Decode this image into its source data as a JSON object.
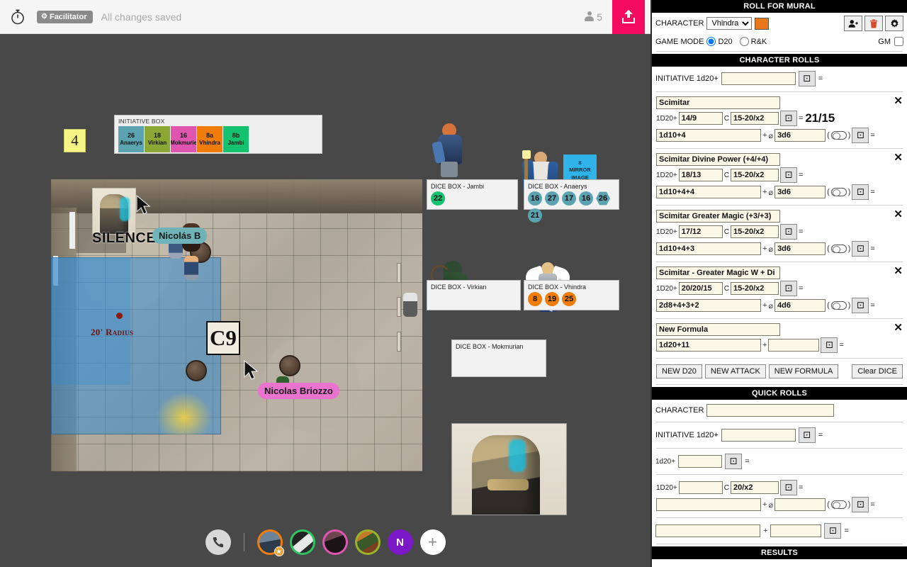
{
  "topbar": {
    "timer_icon": "stopwatch-icon",
    "facilitator_label": "Facilitator",
    "saved_status": "All changes saved",
    "people_count": "5",
    "share_icon": "upload-icon",
    "share_accent": "#f50b5d"
  },
  "canvas": {
    "counter_token": "4",
    "initiative": {
      "title": "INITIATIVE BOX",
      "cards": [
        {
          "num": "26",
          "name": "Anaerys",
          "color": "#5ba3b0"
        },
        {
          "num": "18",
          "name": "Virkian",
          "color": "#8aa833"
        },
        {
          "num": "16",
          "name": "Mokmurie",
          "color": "#e055b0"
        },
        {
          "num": "8a",
          "name": "Vhindra",
          "color": "#f07c0a"
        },
        {
          "num": "8b",
          "name": "Jambi",
          "color": "#14c270"
        }
      ]
    },
    "map": {
      "silence_label": "SILENCE",
      "grid_marker": "C9",
      "radius_label": "20' Radius",
      "nametag_teal": "Nicolás B",
      "nametag_pink": "Nicolas Briozzo"
    },
    "mirror_card": {
      "num": "8",
      "line1": "MIRROR",
      "line2": "IMAGE",
      "color": "#2fb3e8"
    },
    "dice_boxes": [
      {
        "title": "DICE BOX - Jambi",
        "color": "#14c270",
        "dice": [
          "22"
        ]
      },
      {
        "title": "DICE BOX - Anaerys",
        "color": "#5ba3b0",
        "dice": [
          "16",
          "27",
          "17",
          "16",
          "26",
          "21"
        ],
        "hex_index": 4
      },
      {
        "title": "DICE BOX - Virkian",
        "color": "#8aa833",
        "dice": []
      },
      {
        "title": "DICE BOX - Vhindra",
        "color": "#f07c0a",
        "dice": [
          "8",
          "19",
          "25"
        ]
      },
      {
        "title": "DICE BOX - Mokmurian",
        "color": "#e055b0",
        "dice": []
      }
    ]
  },
  "videobar": {
    "call_icon": "phone-icon",
    "add_icon": "plus-icon",
    "avatars": [
      {
        "name": "avatar-1",
        "ring": "#f07c0a",
        "fill": "#4b6680",
        "initial": "",
        "badge": "★"
      },
      {
        "name": "avatar-2",
        "ring": "#2ec45f",
        "fill": "#d8d8d8",
        "initial": ""
      },
      {
        "name": "avatar-3",
        "ring": "#e055b0",
        "fill": "#3b2a32",
        "initial": ""
      },
      {
        "name": "avatar-4",
        "ring": "#9cb22b",
        "fill": "#5d5228",
        "initial": ""
      },
      {
        "name": "avatar-5",
        "ring": "#7b19c9",
        "fill": "#7b19c9",
        "initial": "N"
      }
    ]
  },
  "panel": {
    "title": "ROLL FOR MURAL",
    "character_label": "CHARACTER",
    "character_value": "Vhindra",
    "character_options": [
      "Vhindra"
    ],
    "character_color": "#e8761a",
    "add_user_icon": "add-person-icon",
    "delete_icon": "trash-icon",
    "settings_icon": "gear-icon",
    "game_mode_label": "GAME MODE",
    "game_mode_options": [
      "D20",
      "R&K"
    ],
    "game_mode_selected": "D20",
    "gm_label": "GM",
    "gm_checked": false,
    "character_rolls_header": "CHARACTER ROLLS",
    "initiative_label": "INITIATIVE 1d20+",
    "initiative_value": "",
    "initiative_result": "",
    "attacks": [
      {
        "name": "Scimitar",
        "d20_label": "1D20+",
        "attack_mod": "14/9",
        "crit_label": "C",
        "crit": "15-20/x2",
        "attack_result": "21/15",
        "damage": "1d10+4",
        "plus_label": "+",
        "bonus_label": "⌀",
        "bonus_damage": "3d6",
        "damage_result": ""
      },
      {
        "name": "Scimitar Divine Power (+4/+4)",
        "d20_label": "1D20+",
        "attack_mod": "18/13",
        "crit_label": "C",
        "crit": "15-20/x2",
        "attack_result": "",
        "damage": "1d10+4+4",
        "plus_label": "+",
        "bonus_label": "⌀",
        "bonus_damage": "3d6",
        "damage_result": ""
      },
      {
        "name": "Scimitar Greater Magic (+3/+3)",
        "d20_label": "1D20+",
        "attack_mod": "17/12",
        "crit_label": "C",
        "crit": "15-20/x2",
        "attack_result": "",
        "damage": "1d10+4+3",
        "plus_label": "+",
        "bonus_label": "⌀",
        "bonus_damage": "3d6",
        "damage_result": ""
      },
      {
        "name": "Scimitar - Greater Magic W + Di",
        "d20_label": "1D20+",
        "attack_mod": "20/20/15",
        "crit_label": "C",
        "crit": "15-20/x2",
        "attack_result": "",
        "damage": "2d8+4+3+2",
        "plus_label": "+",
        "bonus_label": "⌀",
        "bonus_damage": "4d6",
        "damage_result": ""
      }
    ],
    "formula": {
      "name": "New Formula",
      "expression": "1d20+11",
      "plus_label": "+",
      "addend": "",
      "result": ""
    },
    "buttons": {
      "new_d20": "NEW D20",
      "new_attack": "NEW ATTACK",
      "new_formula": "NEW FORMULA",
      "clear_dice": "Clear DICE"
    },
    "quick_rolls_header": "QUICK ROLLS",
    "quick": {
      "character_label": "CHARACTER",
      "character_value": "",
      "initiative_label": "INITIATIVE 1d20+",
      "initiative_value": "",
      "d20_label": "1d20+",
      "d20_value": "",
      "attack_d20_label": "1D20+",
      "attack_mod": "",
      "crit_label": "C",
      "crit": "20/x2",
      "damage": "",
      "plus_label": "+",
      "bonus_label": "⌀",
      "bonus_damage": "",
      "formula_a": "",
      "formula_plus": "+",
      "formula_b": ""
    },
    "results_header": "RESULTS"
  }
}
